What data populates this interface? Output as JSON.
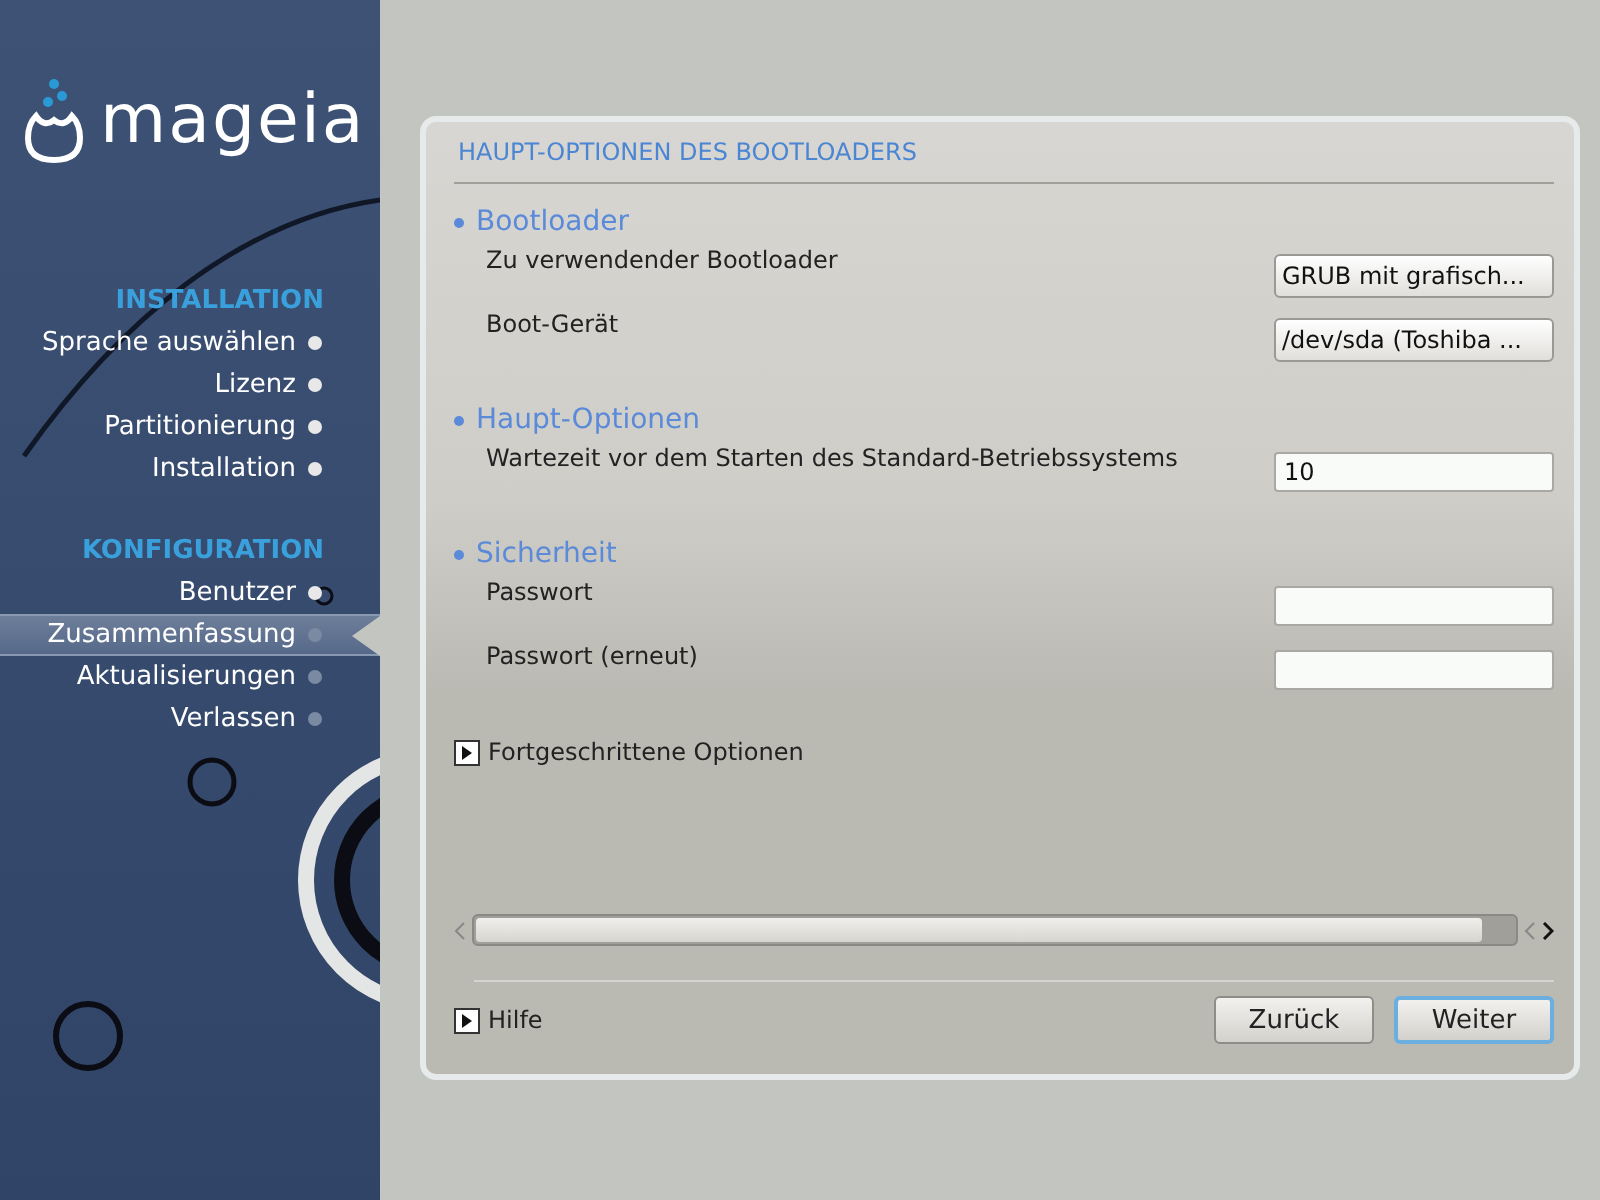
{
  "sidebar": {
    "logo": "mageia",
    "sections": [
      {
        "title": "INSTALLATION",
        "items": [
          {
            "label": "Sprache auswählen",
            "done": true,
            "selected": false
          },
          {
            "label": "Lizenz",
            "done": true,
            "selected": false
          },
          {
            "label": "Partitionierung",
            "done": true,
            "selected": false
          },
          {
            "label": "Installation",
            "done": true,
            "selected": false
          }
        ]
      },
      {
        "title": "KONFIGURATION",
        "items": [
          {
            "label": "Benutzer",
            "done": true,
            "selected": false
          },
          {
            "label": "Zusammenfassung",
            "done": false,
            "selected": true
          },
          {
            "label": "Aktualisierungen",
            "done": false,
            "selected": false
          },
          {
            "label": "Verlassen",
            "done": false,
            "selected": false
          }
        ]
      }
    ]
  },
  "panel": {
    "title": "HAUPT-OPTIONEN DES BOOTLOADERS",
    "groups": [
      {
        "heading": "Bootloader",
        "rows": [
          {
            "label": "Zu verwendender Bootloader",
            "kind": "combo",
            "value": "GRUB mit grafisch..."
          },
          {
            "label": "Boot-Gerät",
            "kind": "combo",
            "value": "/dev/sda (Toshiba ..."
          }
        ]
      },
      {
        "heading": "Haupt-Optionen",
        "rows": [
          {
            "label": "Wartezeit vor dem Starten des Standard-Betriebssystems",
            "kind": "entry",
            "value": "10"
          }
        ]
      },
      {
        "heading": "Sicherheit",
        "rows": [
          {
            "label": "Passwort",
            "kind": "entry"
          },
          {
            "label": "Passwort (erneut)",
            "kind": "entry"
          }
        ]
      }
    ],
    "advanced": {
      "label": "Fortgeschrittene Optionen",
      "expanded": false
    },
    "help": {
      "label": "Hilfe",
      "expanded": false
    },
    "buttons": [
      {
        "label": "Zurück",
        "focused": false
      },
      {
        "label": "Weiter",
        "focused": true
      }
    ]
  }
}
